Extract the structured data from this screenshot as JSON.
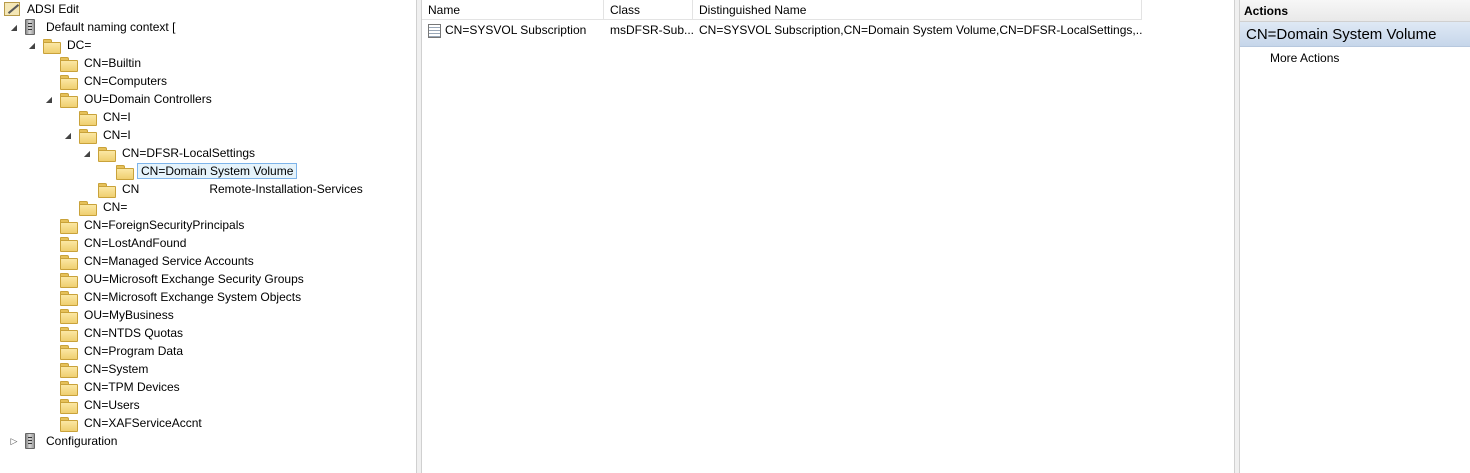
{
  "tree": {
    "root_label": "ADSI Edit",
    "naming_context_label": "Default naming context [",
    "dc_label": "DC=",
    "items": [
      {
        "label": "CN=Builtin"
      },
      {
        "label": "CN=Computers"
      },
      {
        "label": "OU=Domain Controllers"
      },
      {
        "label": "CN=I"
      },
      {
        "label": "CN=I"
      },
      {
        "label": "CN=DFSR-LocalSettings"
      },
      {
        "label": "CN=Domain System Volume"
      },
      {
        "label": "CN",
        "label_suffix": "Remote-Installation-Services"
      },
      {
        "label": "CN="
      },
      {
        "label": "CN=ForeignSecurityPrincipals"
      },
      {
        "label": "CN=LostAndFound"
      },
      {
        "label": "CN=Managed Service Accounts"
      },
      {
        "label": "OU=Microsoft Exchange Security Groups"
      },
      {
        "label": "CN=Microsoft Exchange System Objects"
      },
      {
        "label": "OU=MyBusiness"
      },
      {
        "label": "CN=NTDS Quotas"
      },
      {
        "label": "CN=Program Data"
      },
      {
        "label": "CN=System"
      },
      {
        "label": "CN=TPM Devices"
      },
      {
        "label": "CN=Users"
      },
      {
        "label": "CN=XAFServiceAccnt"
      }
    ],
    "configuration_label": "Configuration"
  },
  "list": {
    "columns": [
      {
        "label": "Name"
      },
      {
        "label": "Class"
      },
      {
        "label": "Distinguished Name"
      }
    ],
    "rows": [
      {
        "name": "CN=SYSVOL Subscription",
        "class": "msDFSR-Sub...",
        "dn": "CN=SYSVOL Subscription,CN=Domain System Volume,CN=DFSR-LocalSettings,..."
      }
    ]
  },
  "actions": {
    "title": "Actions",
    "group_label": "CN=Domain System Volume",
    "more_actions_label": "More Actions"
  }
}
